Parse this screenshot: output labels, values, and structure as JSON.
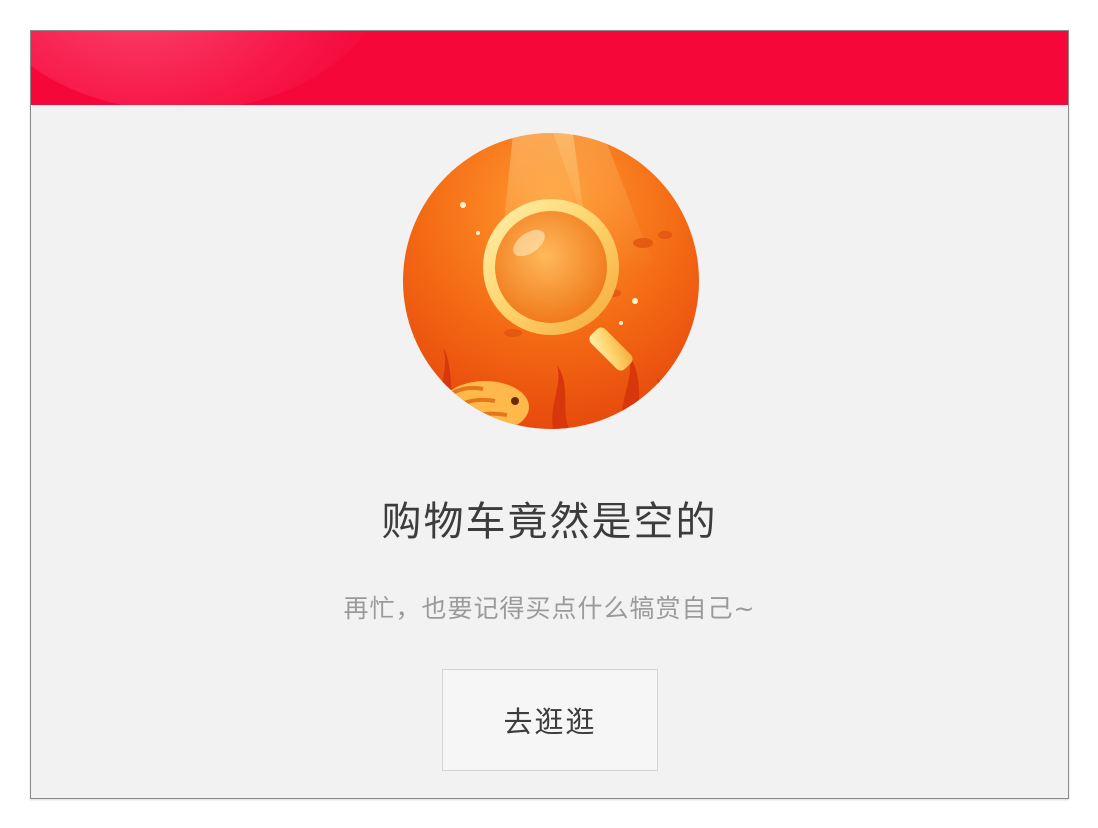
{
  "empty_cart": {
    "title": "购物车竟然是空的",
    "subtitle": "再忙，也要记得买点什么犒赏自己~",
    "button_label": "去逛逛",
    "illustration_icon": "magnifier-underwater-icon"
  },
  "colors": {
    "header": "#f5073a",
    "background": "#f2f2f2",
    "illustration_orange": "#f26a12",
    "title_text": "#3c3c3c",
    "subtitle_text": "#9a9a9a"
  }
}
